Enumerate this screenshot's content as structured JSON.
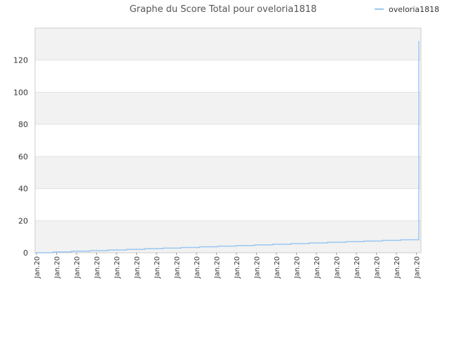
{
  "chart_data": {
    "type": "line",
    "title": "Graphe du Score Total pour oveloria1818",
    "xlabel": "",
    "ylabel": "",
    "ylim": [
      0,
      140
    ],
    "yticks": [
      0,
      20,
      40,
      60,
      80,
      100,
      120
    ],
    "grid": true,
    "band_colors": [
      "#f2f2f2",
      "#ffffff"
    ],
    "legend_position": "top-right",
    "categories": [
      "Jan.20",
      "Jan.20",
      "Jan.20",
      "Jan.20",
      "Jan.20",
      "Jan.20",
      "Jan.20",
      "Jan.20",
      "Jan.20",
      "Jan.20",
      "Jan.20",
      "Jan.20",
      "Jan.20",
      "Jan.20",
      "Jan.20",
      "Jan.20",
      "Jan.20",
      "Jan.20",
      "Jan.20",
      "Jan.20"
    ],
    "series": [
      {
        "name": "oveloria1818",
        "color": "#99c7f0",
        "step": true,
        "values": [
          0,
          0.5,
          1,
          1.3,
          1.7,
          2.1,
          2.5,
          2.9,
          3.3,
          3.7,
          4.1,
          4.5,
          4.9,
          5.3,
          5.7,
          6.1,
          6.5,
          6.9,
          7.3,
          7.7,
          8.1,
          132
        ]
      }
    ]
  }
}
